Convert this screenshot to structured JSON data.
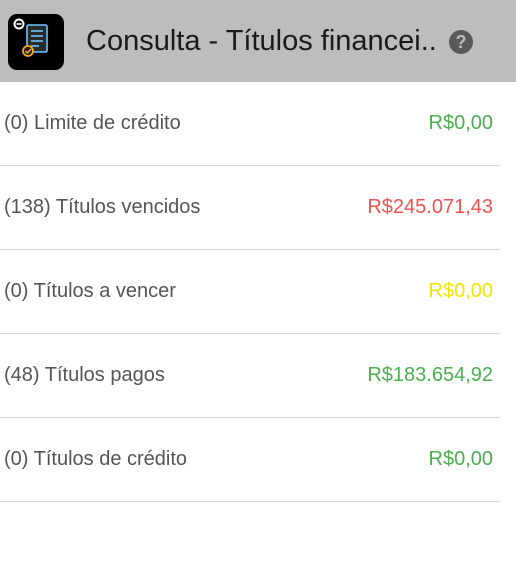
{
  "app_bar": {
    "title": "Consulta - Títulos financei...",
    "app_icon": "document-app-icon",
    "help_icon": "help-icon",
    "help_glyph": "?"
  },
  "items": [
    {
      "label": "(0) Limite de crédito",
      "value": "R$0,00",
      "color": "#4caf50"
    },
    {
      "label": "(138) Títulos vencidos",
      "value": "R$245.071,43",
      "color": "#ef5350"
    },
    {
      "label": "(0) Títulos a vencer",
      "value": "R$0,00",
      "color": "#f2e600"
    },
    {
      "label": "(48) Títulos pagos",
      "value": "R$183.654,92",
      "color": "#4caf50"
    },
    {
      "label": "(0) Títulos de crédito",
      "value": "R$0,00",
      "color": "#4caf50"
    }
  ]
}
